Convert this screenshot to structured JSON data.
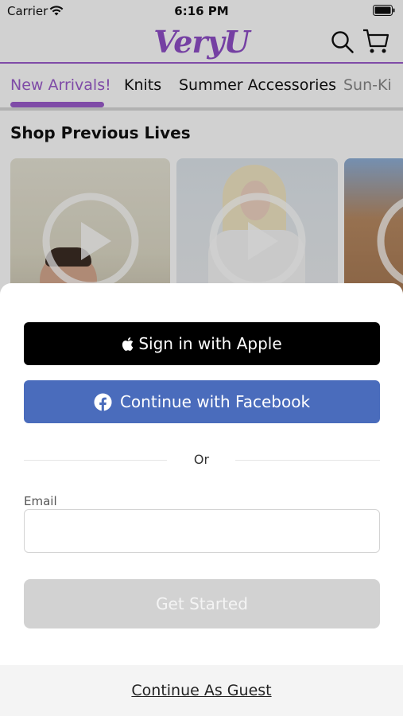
{
  "status_bar": {
    "carrier": "Carrier",
    "time": "6:16 PM",
    "icons": [
      "wifi-icon",
      "battery-icon"
    ]
  },
  "header": {
    "logo_text": "VeryU",
    "brand_color": "#8f4fc7",
    "icons": [
      "search-icon",
      "cart-icon"
    ]
  },
  "category_tabs": [
    {
      "label": "New Arrivals!",
      "active": true
    },
    {
      "label": "Knits",
      "active": false
    },
    {
      "label": "Summer Accessories",
      "active": false
    },
    {
      "label": "Sun-Ki",
      "active": false
    }
  ],
  "section": {
    "title": "Shop Previous Lives",
    "cards": [
      {
        "icon": "play-icon"
      },
      {
        "icon": "play-icon"
      },
      {
        "icon": "play-icon"
      }
    ]
  },
  "signin_sheet": {
    "apple_button": "Sign in with Apple",
    "facebook_button": "Continue with Facebook",
    "divider_text": "Or",
    "email_label": "Email",
    "email_value": "",
    "email_placeholder": "",
    "get_started_button": "Get Started",
    "guest_link": "Continue As Guest",
    "colors": {
      "apple": "#000000",
      "facebook": "#4a6cbc",
      "disabled_button": "#d2d2d2"
    }
  }
}
